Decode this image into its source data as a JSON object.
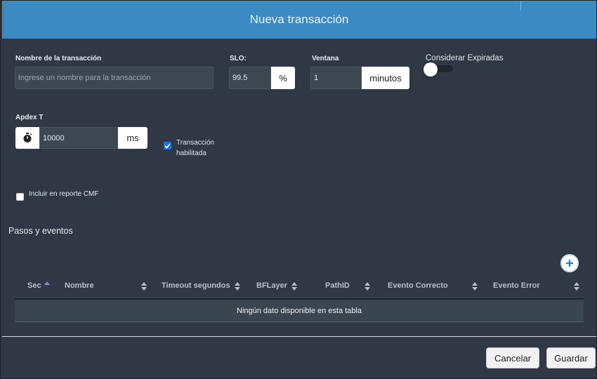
{
  "modal": {
    "title": "Nueva transacción"
  },
  "form": {
    "name_label": "Nombre de la transacción",
    "name_placeholder": "Ingrese un nombre para la transacción",
    "slo_label": "SLO:",
    "slo_value": "99.5",
    "slo_unit": "%",
    "window_label": "Ventana",
    "window_value": "1",
    "window_unit": "minutos",
    "expired_label": "Considerar Expiradas",
    "expired_enabled": false,
    "apdex_label": "Apdex T",
    "apdex_value": "10000",
    "apdex_unit": "ms",
    "apdex_icon": "stopwatch-icon",
    "enabled_label_line1": "Transacción",
    "enabled_label_line2": "habilitada",
    "enabled_checked": true,
    "cmf_label": "Incluir en reporte CMF",
    "cmf_checked": false
  },
  "steps": {
    "title": "Pasos y eventos",
    "add_icon": "plus-circle-icon",
    "columns": [
      "Sec",
      "Nombre",
      "Timeout segundos",
      "BFLayer",
      "PathID",
      "Evento Correcto",
      "Evento Error"
    ],
    "empty_message": "Ningún dato disponible en esta tabla"
  },
  "footer": {
    "cancel_label": "Cancelar",
    "save_label": "Guardar"
  },
  "colors": {
    "header": "#3b8bc2",
    "background": "#2f3844",
    "accent": "#1a73e8"
  }
}
